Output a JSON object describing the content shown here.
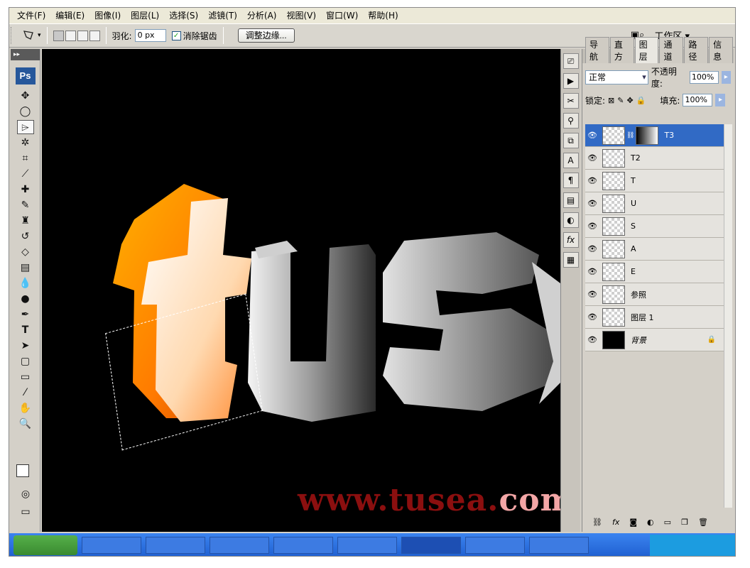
{
  "menu": [
    "文件(F)",
    "编辑(E)",
    "图像(I)",
    "图层(L)",
    "选择(S)",
    "滤镜(T)",
    "分析(A)",
    "视图(V)",
    "窗口(W)",
    "帮助(H)"
  ],
  "options": {
    "feather_label": "羽化:",
    "feather_value": "0 px",
    "antialias_label": "消除锯齿",
    "antialias_checked": true,
    "refine_edge_button": "调整边缘...",
    "workspace_label": "工作区"
  },
  "tools_header": "▸▸",
  "ps_logo": "Ps",
  "canvas": {
    "watermark_main": "www.tusea.",
    "watermark_tail": "com",
    "title_text": "tuse"
  },
  "layers_panel": {
    "tabs": [
      "导航",
      "直方",
      "图层",
      "通道",
      "路径",
      "信息"
    ],
    "active_tab": "图层",
    "blend_mode": "正常",
    "opacity_label": "不透明度:",
    "opacity_value": "100%",
    "lock_label": "锁定:",
    "fill_label": "填充:",
    "fill_value": "100%",
    "layers": [
      {
        "name": "T3",
        "selected": true,
        "has_mask": true
      },
      {
        "name": "T2"
      },
      {
        "name": "T"
      },
      {
        "name": "U"
      },
      {
        "name": "S"
      },
      {
        "name": "A"
      },
      {
        "name": "E"
      },
      {
        "name": "参照"
      },
      {
        "name": "图层 1"
      },
      {
        "name": "背景",
        "italic": true,
        "locked": true
      }
    ]
  },
  "colors": {
    "canvas_bg": "#000000",
    "selected_layer": "#316ac5",
    "watermark": "#8b0f0f"
  }
}
